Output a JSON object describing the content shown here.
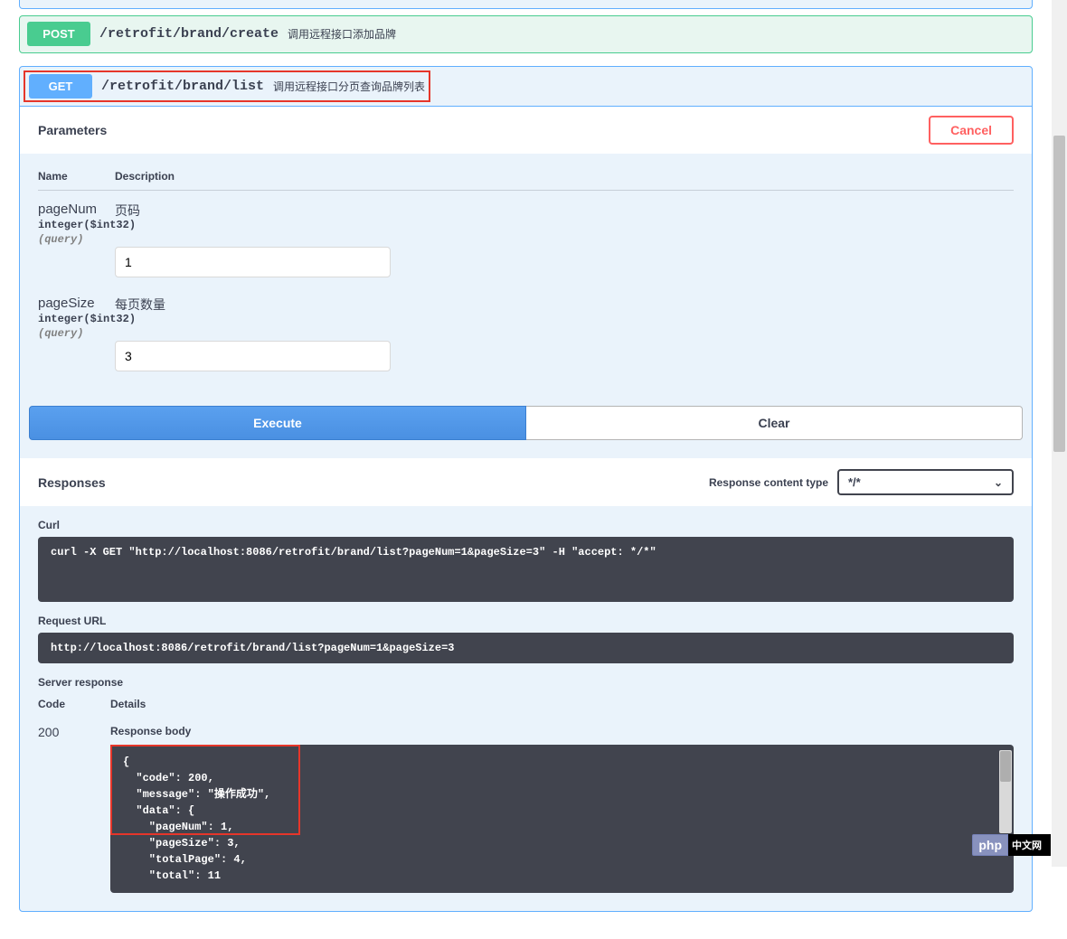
{
  "endpoints": {
    "post": {
      "method": "POST",
      "path": "/retrofit/brand/create",
      "desc": "调用远程接口添加品牌"
    },
    "get": {
      "method": "GET",
      "path": "/retrofit/brand/list",
      "desc": "调用远程接口分页查询品牌列表"
    }
  },
  "labels": {
    "parameters": "Parameters",
    "cancel": "Cancel",
    "name_col": "Name",
    "desc_col": "Description",
    "execute": "Execute",
    "clear": "Clear",
    "responses": "Responses",
    "content_type_label": "Response content type",
    "curl": "Curl",
    "request_url": "Request URL",
    "server_response": "Server response",
    "code_col": "Code",
    "details_col": "Details",
    "response_body": "Response body"
  },
  "params": [
    {
      "name": "pageNum",
      "type": "integer($int32)",
      "in": "(query)",
      "desc": "页码",
      "value": "1"
    },
    {
      "name": "pageSize",
      "type": "integer($int32)",
      "in": "(query)",
      "desc": "每页数量",
      "value": "3"
    }
  ],
  "content_type": "*/*",
  "curl_cmd": "curl -X GET \"http://localhost:8086/retrofit/brand/list?pageNum=1&pageSize=3\" -H \"accept: */*\"",
  "request_url": "http://localhost:8086/retrofit/brand/list?pageNum=1&pageSize=3",
  "response": {
    "code": "200",
    "body": "{\n  \"code\": 200,\n  \"message\": \"操作成功\",\n  \"data\": {\n    \"pageNum\": 1,\n    \"pageSize\": 3,\n    \"totalPage\": 4,\n    \"total\": 11"
  },
  "watermark": {
    "left": "php",
    "right": "中文网"
  }
}
